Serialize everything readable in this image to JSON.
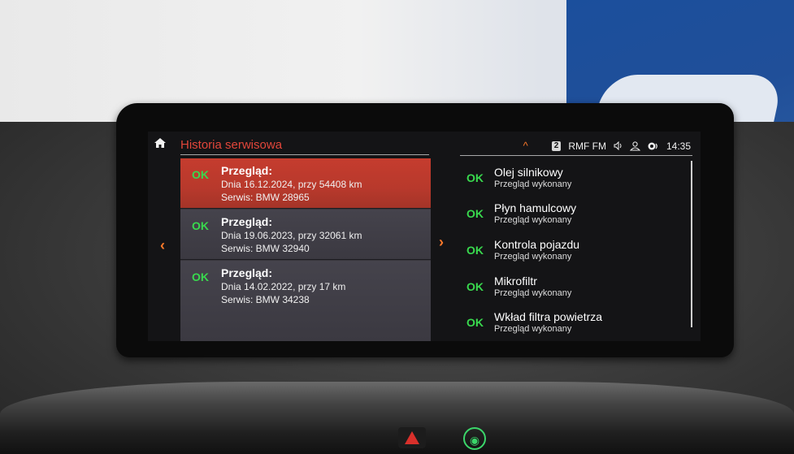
{
  "topbar": {
    "title": "Historia serwisowa",
    "radio_badge": "2",
    "radio_station": "RMF FM",
    "time": "14:35",
    "icons": [
      "home-icon",
      "chevron-up-icon",
      "volume-icon",
      "user-profile-icon",
      "connectivity-icon"
    ]
  },
  "service_history": [
    {
      "status": "OK",
      "heading": "Przegląd:",
      "line1": "Dnia 16.12.2024, przy 54408 km",
      "line2": "Serwis: BMW 28965",
      "selected": true
    },
    {
      "status": "OK",
      "heading": "Przegląd:",
      "line1": "Dnia 19.06.2023, przy 32061 km",
      "line2": "Serwis: BMW 32940",
      "selected": false
    },
    {
      "status": "OK",
      "heading": "Przegląd:",
      "line1": "Dnia 14.02.2022, przy 17 km",
      "line2": "Serwis: BMW 34238",
      "selected": false
    }
  ],
  "checks": [
    {
      "status": "OK",
      "name": "Olej silnikowy",
      "sub": "Przegląd wykonany"
    },
    {
      "status": "OK",
      "name": "Płyn hamulcowy",
      "sub": "Przegląd wykonany"
    },
    {
      "status": "OK",
      "name": "Kontrola pojazdu",
      "sub": "Przegląd wykonany"
    },
    {
      "status": "OK",
      "name": "Mikrofiltr",
      "sub": "Przegląd wykonany"
    },
    {
      "status": "OK",
      "name": "Wkład filtra powietrza",
      "sub": "Przegląd wykonany"
    }
  ],
  "nav": {
    "left_arrow": "‹",
    "right_arrow": "›"
  },
  "colors": {
    "accent": "#ff7a2a",
    "title_red": "#e2463a",
    "ok_green": "#39d94e",
    "selected_row": "#c53c2e"
  }
}
